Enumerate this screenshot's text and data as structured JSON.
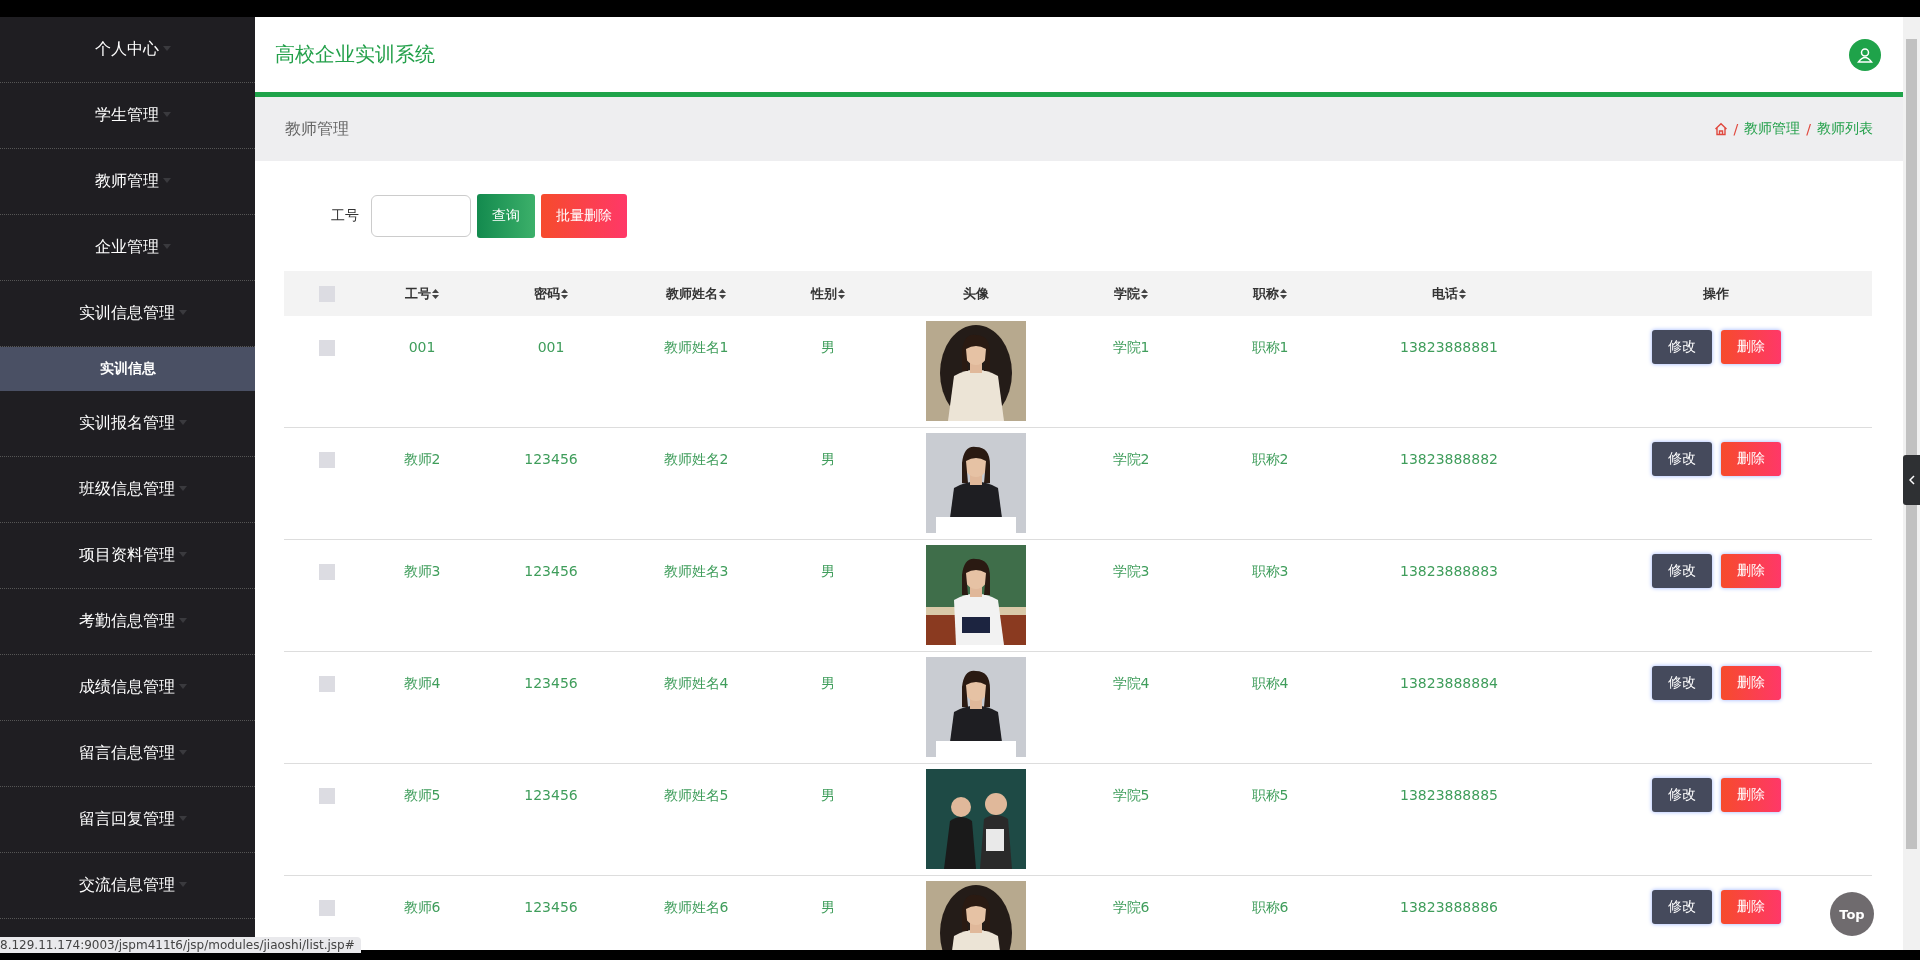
{
  "sidebar": {
    "items": [
      {
        "label": "个人中心"
      },
      {
        "label": "学生管理"
      },
      {
        "label": "教师管理"
      },
      {
        "label": "企业管理"
      },
      {
        "label": "实训信息管理",
        "children": [
          {
            "label": "实训信息",
            "selected": true
          }
        ]
      },
      {
        "label": "实训报名管理"
      },
      {
        "label": "班级信息管理"
      },
      {
        "label": "项目资料管理"
      },
      {
        "label": "考勤信息管理"
      },
      {
        "label": "成绩信息管理"
      },
      {
        "label": "留言信息管理"
      },
      {
        "label": "留言回复管理"
      },
      {
        "label": "交流信息管理"
      }
    ]
  },
  "header": {
    "title": "高校企业实训系统"
  },
  "breadcrumb_bar": {
    "title": "教师管理",
    "trail": [
      {
        "separator": "/",
        "label": "教师管理"
      },
      {
        "separator": "/",
        "label": "教师列表"
      }
    ]
  },
  "search": {
    "label": "工号",
    "buttons": [
      {
        "label": "查询",
        "kind": "query"
      },
      {
        "label": "批量删除",
        "kind": "delete"
      }
    ]
  },
  "table": {
    "columns": [
      {
        "kind": "checkbox",
        "checked": false
      },
      {
        "kind": "text",
        "label": "工号",
        "sortable": true
      },
      {
        "kind": "text",
        "label": "密码",
        "sortable": true
      },
      {
        "kind": "text",
        "label": "教师姓名",
        "sortable": true
      },
      {
        "kind": "text",
        "label": "性别",
        "sortable": true
      },
      {
        "kind": "picture",
        "label": "头像",
        "sortable": false
      },
      {
        "kind": "text",
        "label": "学院",
        "sortable": true
      },
      {
        "kind": "text",
        "label": "职称",
        "sortable": true
      },
      {
        "kind": "text",
        "label": "电话",
        "sortable": true
      },
      {
        "kind": "actions",
        "label": "操作",
        "sortable": false
      }
    ],
    "rows": [
      {
        "cells": [
          {
            "kind": "checkbox",
            "checked": false
          },
          "001",
          "001",
          "教师姓名1",
          "男",
          {
            "kind": "picture"
          },
          "学院1",
          "职称1",
          "13823888881",
          [
            {
              "label": "修改",
              "kind": "edit"
            },
            {
              "label": "删除",
              "kind": "delete"
            }
          ]
        ]
      },
      {
        "cells": [
          {
            "kind": "checkbox",
            "checked": false
          },
          "教师2",
          "123456",
          "教师姓名2",
          "男",
          {
            "kind": "picture"
          },
          "学院2",
          "职称2",
          "13823888882",
          [
            {
              "label": "修改",
              "kind": "edit"
            },
            {
              "label": "删除",
              "kind": "delete"
            }
          ]
        ]
      },
      {
        "cells": [
          {
            "kind": "checkbox",
            "checked": false
          },
          "教师3",
          "123456",
          "教师姓名3",
          "男",
          {
            "kind": "picture"
          },
          "学院3",
          "职称3",
          "13823888883",
          [
            {
              "label": "修改",
              "kind": "edit"
            },
            {
              "label": "删除",
              "kind": "delete"
            }
          ]
        ]
      },
      {
        "cells": [
          {
            "kind": "checkbox",
            "checked": false
          },
          "教师4",
          "123456",
          "教师姓名4",
          "男",
          {
            "kind": "picture"
          },
          "学院4",
          "职称4",
          "13823888884",
          [
            {
              "label": "修改",
              "kind": "edit"
            },
            {
              "label": "删除",
              "kind": "delete"
            }
          ]
        ]
      },
      {
        "cells": [
          {
            "kind": "checkbox",
            "checked": false
          },
          "教师5",
          "123456",
          "教师姓名5",
          "男",
          {
            "kind": "picture"
          },
          "学院5",
          "职称5",
          "13823888885",
          [
            {
              "label": "修改",
              "kind": "edit"
            },
            {
              "label": "删除",
              "kind": "delete"
            }
          ]
        ]
      },
      {
        "cells": [
          {
            "kind": "checkbox",
            "checked": false
          },
          "教师6",
          "123456",
          "教师姓名6",
          "男",
          {
            "kind": "picture"
          },
          "学院6",
          "职称6",
          "13823888886",
          [
            {
              "label": "修改",
              "kind": "edit"
            },
            {
              "label": "删除",
              "kind": "delete"
            }
          ]
        ]
      }
    ]
  },
  "status_url": "8.129.11.174:9003/jspm411t6/jsp/modules/jiaoshi/list.jsp#",
  "top_button": "Top"
}
